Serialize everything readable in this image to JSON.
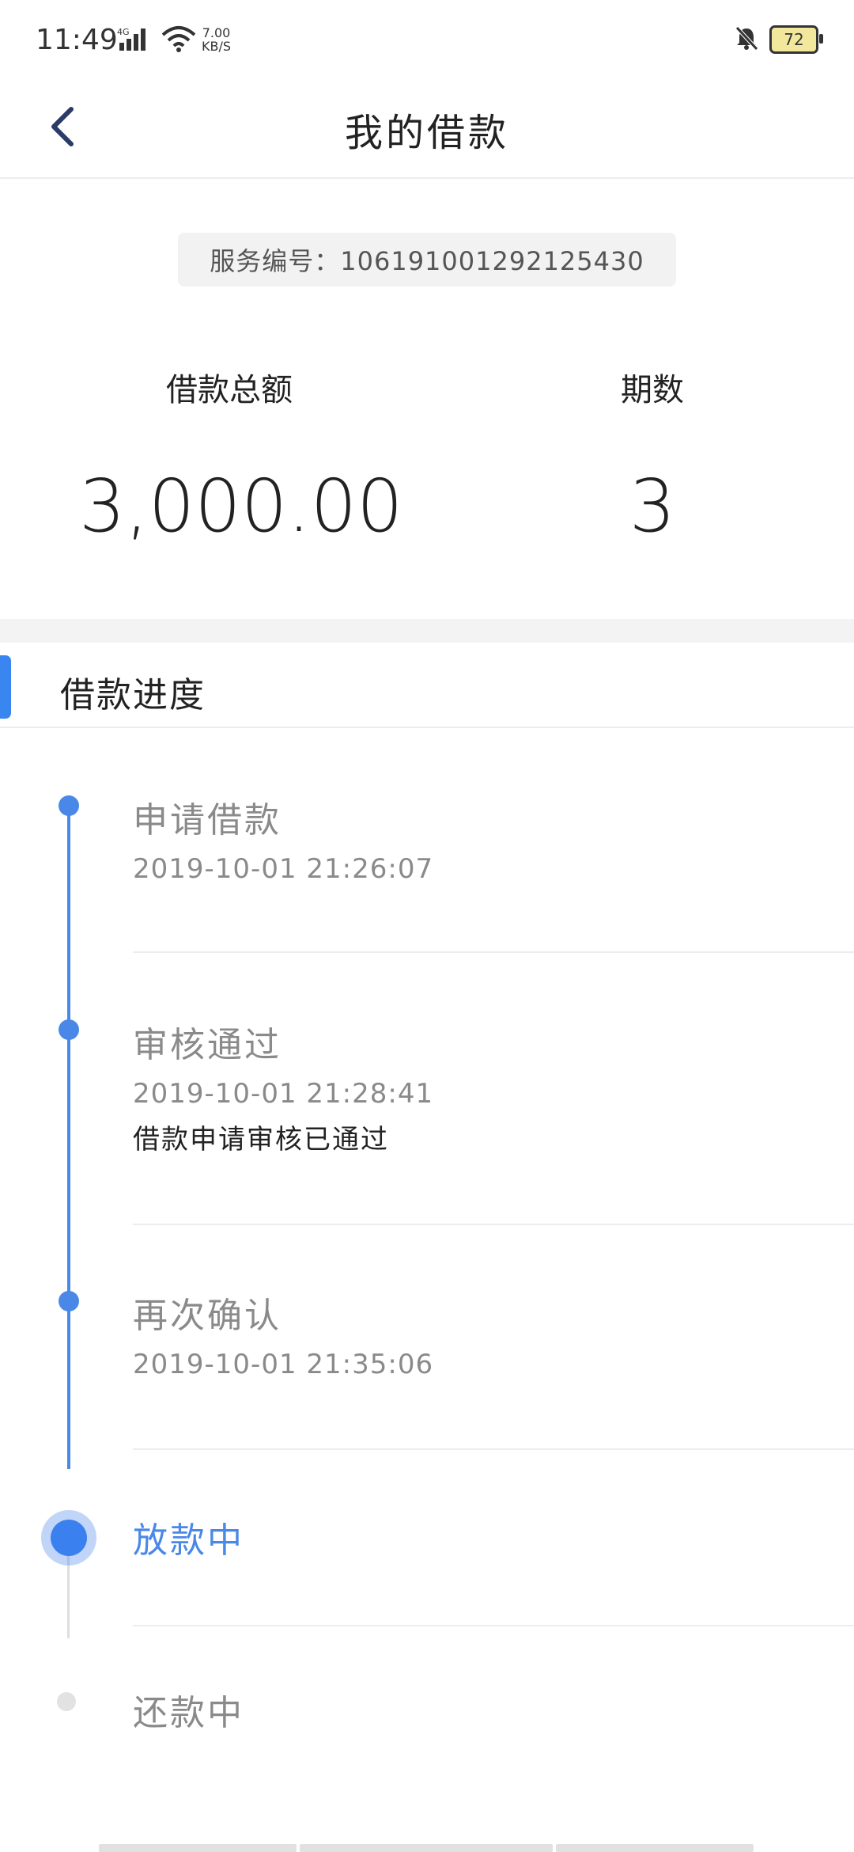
{
  "status_bar": {
    "time": "11:49",
    "network": "4G",
    "speed_value": "7.00",
    "speed_unit": "KB/S",
    "battery": "72"
  },
  "header": {
    "title": "我的借款",
    "back_icon": "chevron-left-icon"
  },
  "summary": {
    "service_number": "服务编号：10619100129212543​0",
    "amount_label": "借款总额",
    "amount_value": "3,000.00",
    "periods_label": "期数",
    "periods_value": "3"
  },
  "progress": {
    "title": "借款进度",
    "steps": [
      {
        "title": "申请借款",
        "time": "2019-10-01 21:26:07",
        "status": "done"
      },
      {
        "title": "审核通过",
        "time": "2019-10-01 21:28:41",
        "note": "借款申请审核已通过",
        "status": "done"
      },
      {
        "title": "再次确认",
        "time": "2019-10-01 21:35:06",
        "status": "done"
      },
      {
        "title": "放款中",
        "status": "current"
      },
      {
        "title": "还款中",
        "status": "pending"
      }
    ]
  },
  "colors": {
    "accent": "#4a88e8",
    "pending": "#dedede",
    "muted_text": "#8a8a8a"
  }
}
